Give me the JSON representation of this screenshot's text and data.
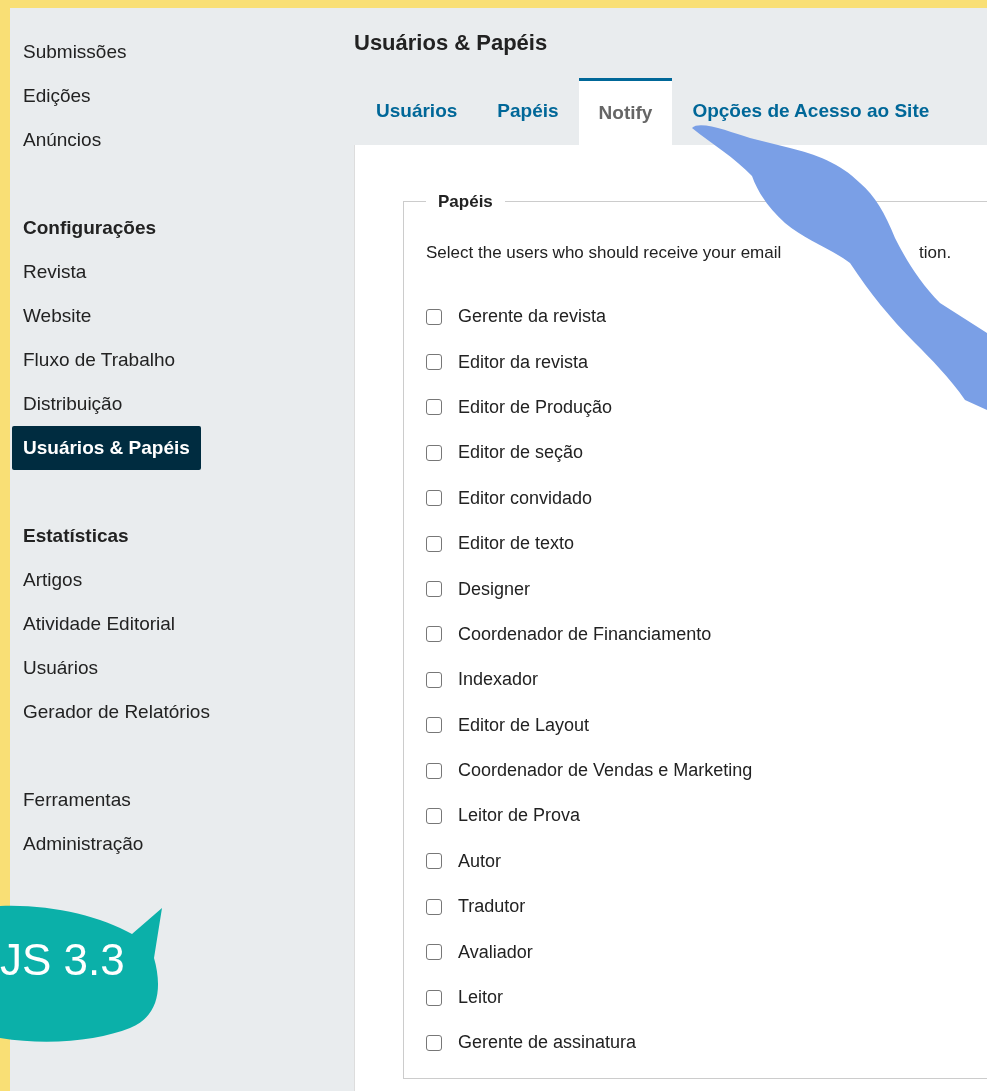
{
  "sidebar": {
    "sections": [
      {
        "items": [
          {
            "label": "Submissões",
            "selected": false
          },
          {
            "label": "Edições",
            "selected": false
          },
          {
            "label": "Anúncios",
            "selected": false
          }
        ]
      },
      {
        "heading": "Configurações",
        "items": [
          {
            "label": "Revista",
            "selected": false
          },
          {
            "label": "Website",
            "selected": false
          },
          {
            "label": "Fluxo de Trabalho",
            "selected": false
          },
          {
            "label": "Distribuição",
            "selected": false
          },
          {
            "label": "Usuários & Papéis",
            "selected": true
          }
        ]
      },
      {
        "heading": "Estatísticas",
        "items": [
          {
            "label": "Artigos",
            "selected": false
          },
          {
            "label": "Atividade Editorial",
            "selected": false
          },
          {
            "label": "Usuários",
            "selected": false
          },
          {
            "label": "Gerador de Relatórios",
            "selected": false
          }
        ]
      },
      {
        "items": [
          {
            "label": "Ferramentas",
            "selected": false
          },
          {
            "label": "Administração",
            "selected": false
          }
        ]
      }
    ]
  },
  "page_title": "Usuários & Papéis",
  "tabs": [
    {
      "label": "Usuários",
      "selected": false
    },
    {
      "label": "Papéis",
      "selected": false
    },
    {
      "label": "Notify",
      "selected": true
    },
    {
      "label": "Opções de Acesso ao Site",
      "selected": false
    }
  ],
  "fieldset": {
    "legend": "Papéis",
    "description": [
      "Select the users who should receive your email",
      "tion."
    ],
    "roles": [
      {
        "label": "Gerente da revista",
        "checked": false
      },
      {
        "label": "Editor da revista",
        "checked": false
      },
      {
        "label": "Editor de Produção",
        "checked": false
      },
      {
        "label": "Editor de seção",
        "checked": false
      },
      {
        "label": "Editor convidado",
        "checked": false
      },
      {
        "label": "Editor de texto",
        "checked": false
      },
      {
        "label": "Designer",
        "checked": false
      },
      {
        "label": "Coordenador de Financiamento",
        "checked": false
      },
      {
        "label": "Indexador",
        "checked": false
      },
      {
        "label": "Editor de Layout",
        "checked": false
      },
      {
        "label": "Coordenador de Vendas e Marketing",
        "checked": false
      },
      {
        "label": "Leitor de Prova",
        "checked": false
      },
      {
        "label": "Autor",
        "checked": false
      },
      {
        "label": "Tradutor",
        "checked": false
      },
      {
        "label": "Avaliador",
        "checked": false
      },
      {
        "label": "Leitor",
        "checked": false
      },
      {
        "label": "Gerente de assinatura",
        "checked": false
      }
    ]
  },
  "badge": {
    "text": "JS 3.3"
  }
}
